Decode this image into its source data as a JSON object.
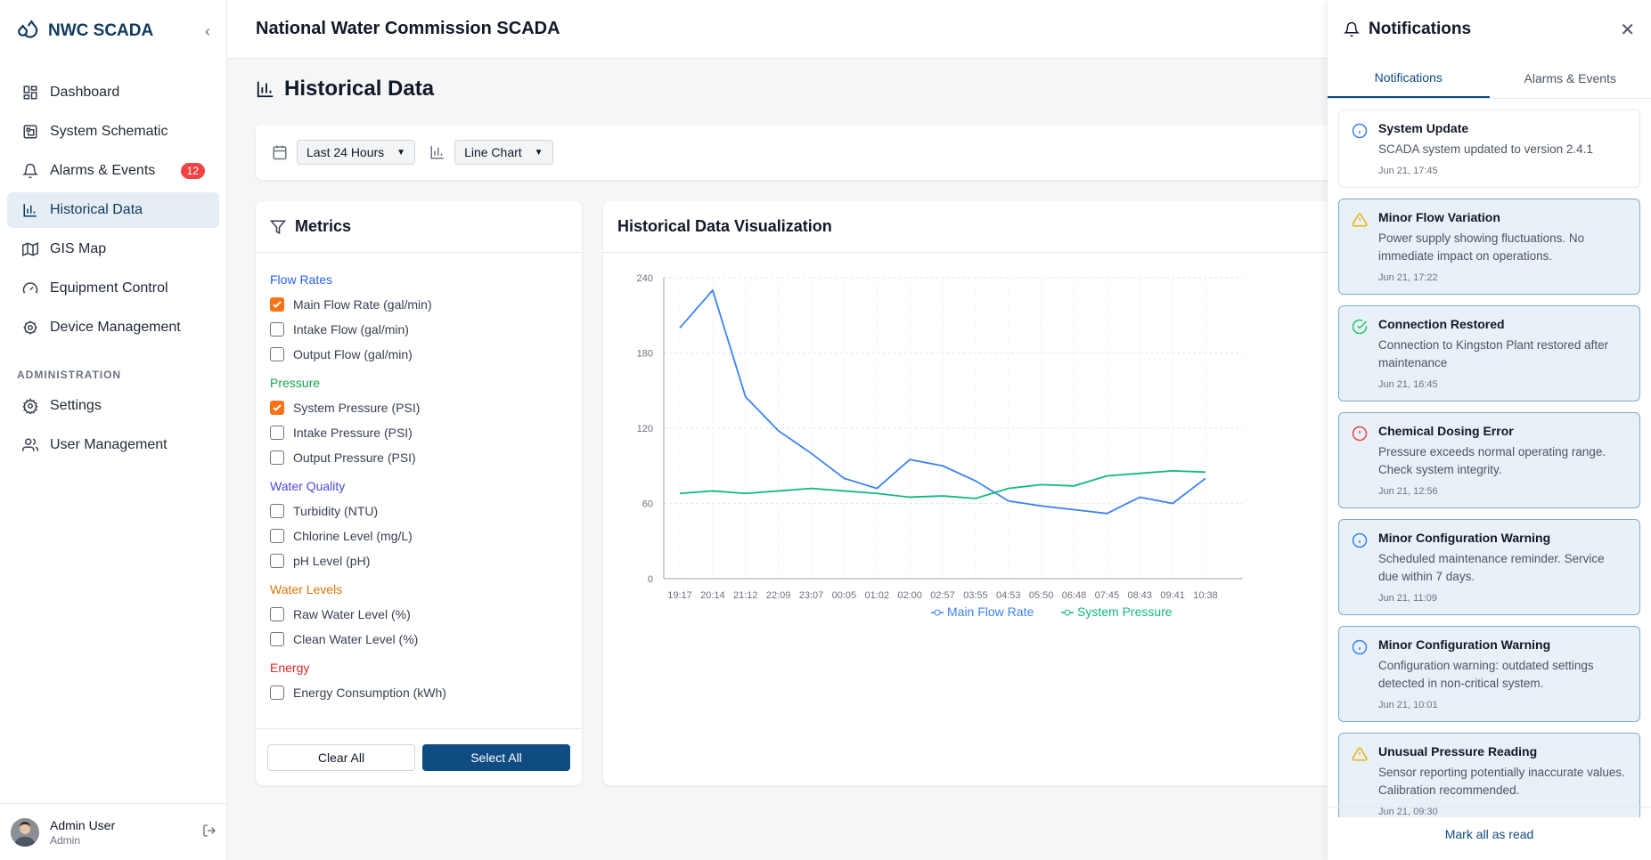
{
  "brand": {
    "name": "NWC SCADA"
  },
  "header": {
    "title": "National Water Commission SCADA"
  },
  "nav": {
    "items": [
      {
        "label": "Dashboard",
        "icon": "dashboard-icon"
      },
      {
        "label": "System Schematic",
        "icon": "schematic-icon"
      },
      {
        "label": "Alarms & Events",
        "icon": "bell-icon",
        "badge": "12"
      },
      {
        "label": "Historical Data",
        "icon": "bar-chart-icon",
        "active": true
      },
      {
        "label": "GIS Map",
        "icon": "map-icon"
      },
      {
        "label": "Equipment Control",
        "icon": "gauge-icon"
      },
      {
        "label": "Device Management",
        "icon": "cog-icon"
      }
    ],
    "admin_label": "ADMINISTRATION",
    "admin_items": [
      {
        "label": "Settings",
        "icon": "settings-icon"
      },
      {
        "label": "User Management",
        "icon": "users-icon"
      }
    ]
  },
  "user": {
    "name": "Admin User",
    "role": "Admin"
  },
  "page": {
    "title": "Historical Data"
  },
  "controls": {
    "range": "Last 24 Hours",
    "chart_type": "Line Chart"
  },
  "metrics": {
    "title": "Metrics",
    "groups": [
      {
        "title": "Flow Rates",
        "color": "#2563eb",
        "items": [
          {
            "label": "Main Flow Rate (gal/min)",
            "checked": true
          },
          {
            "label": "Intake Flow (gal/min)",
            "checked": false
          },
          {
            "label": "Output Flow (gal/min)",
            "checked": false
          }
        ]
      },
      {
        "title": "Pressure",
        "color": "#16a34a",
        "items": [
          {
            "label": "System Pressure (PSI)",
            "checked": true
          },
          {
            "label": "Intake Pressure (PSI)",
            "checked": false
          },
          {
            "label": "Output Pressure (PSI)",
            "checked": false
          }
        ]
      },
      {
        "title": "Water Quality",
        "color": "#4f46e5",
        "items": [
          {
            "label": "Turbidity (NTU)",
            "checked": false
          },
          {
            "label": "Chlorine Level (mg/L)",
            "checked": false
          },
          {
            "label": "pH Level (pH)",
            "checked": false
          }
        ]
      },
      {
        "title": "Water Levels",
        "color": "#d97706",
        "items": [
          {
            "label": "Raw Water Level (%)",
            "checked": false
          },
          {
            "label": "Clean Water Level (%)",
            "checked": false
          }
        ]
      },
      {
        "title": "Energy",
        "color": "#dc2626",
        "items": [
          {
            "label": "Energy Consumption (kWh)",
            "checked": false
          }
        ]
      }
    ],
    "clear_label": "Clear All",
    "select_label": "Select All"
  },
  "viz": {
    "title": "Historical Data Visualization"
  },
  "chart_data": {
    "type": "line",
    "x": [
      "19:17",
      "20:14",
      "21:12",
      "22:09",
      "23:07",
      "00:05",
      "01:02",
      "02:00",
      "02:57",
      "03:55",
      "04:53",
      "05:50",
      "06:48",
      "07:45",
      "08:43",
      "09:41",
      "10:38"
    ],
    "ylim": [
      0,
      240
    ],
    "yticks": [
      0,
      60,
      120,
      180,
      240
    ],
    "series": [
      {
        "name": "Main Flow Rate",
        "color": "#3b82f6",
        "values": [
          200,
          230,
          145,
          118,
          100,
          80,
          72,
          95,
          90,
          78,
          62,
          58,
          55,
          52,
          65,
          60,
          80
        ]
      },
      {
        "name": "System Pressure",
        "color": "#10b981",
        "values": [
          68,
          70,
          68,
          70,
          72,
          70,
          68,
          65,
          66,
          64,
          72,
          75,
          74,
          82,
          84,
          86,
          85
        ]
      }
    ]
  },
  "notifications": {
    "title": "Notifications",
    "tabs": [
      "Notifications",
      "Alarms & Events"
    ],
    "items": [
      {
        "title": "System Update",
        "message": "SCADA system updated to version 2.4.1",
        "time": "Jun 21, 17:45",
        "type": "info",
        "unread": false
      },
      {
        "title": "Minor Flow Variation",
        "message": "Power supply showing fluctuations. No immediate impact on operations.",
        "time": "Jun 21, 17:22",
        "type": "warning",
        "unread": true
      },
      {
        "title": "Connection Restored",
        "message": "Connection to Kingston Plant restored after maintenance",
        "time": "Jun 21, 16:45",
        "type": "success",
        "unread": true
      },
      {
        "title": "Chemical Dosing Error",
        "message": "Pressure exceeds normal operating range. Check system integrity.",
        "time": "Jun 21, 12:56",
        "type": "error",
        "unread": true
      },
      {
        "title": "Minor Configuration Warning",
        "message": "Scheduled maintenance reminder. Service due within 7 days.",
        "time": "Jun 21, 11:09",
        "type": "info",
        "unread": true
      },
      {
        "title": "Minor Configuration Warning",
        "message": "Configuration warning: outdated settings detected in non-critical system.",
        "time": "Jun 21, 10:01",
        "type": "info",
        "unread": true
      },
      {
        "title": "Unusual Pressure Reading",
        "message": "Sensor reporting potentially inaccurate values. Calibration recommended.",
        "time": "Jun 21, 09:30",
        "type": "warning",
        "unread": true
      }
    ],
    "mark_all": "Mark all as read"
  }
}
